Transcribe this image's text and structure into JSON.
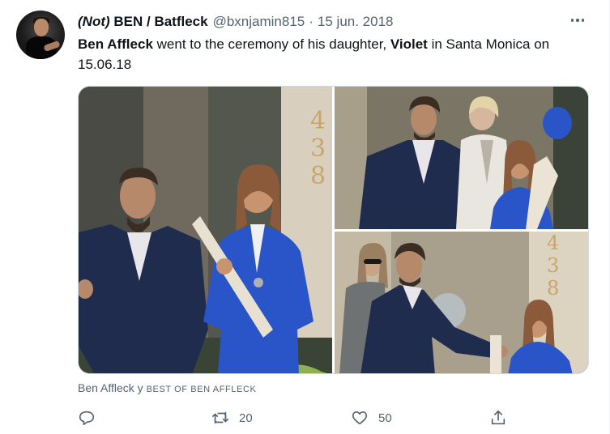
{
  "tweet": {
    "display_name_prefix": "(Not)",
    "display_name": "BEN / Batfleck",
    "handle": "@bxnjamin815",
    "separator": "·",
    "date": "15 jun. 2018",
    "text": {
      "name": "Ben Affleck",
      "part1": " went to the ceremony of his daughter, ",
      "daughter": "Violet",
      "part2": " in Santa Monica on 15.06.18"
    },
    "attribution": {
      "name": "Ben Affleck",
      "joiner": " y ",
      "other": "BEST OF BEN AFFLECK"
    },
    "actions": {
      "reply_count": "",
      "retweet_count": "20",
      "like_count": "50"
    }
  },
  "icons": [
    "more-icon",
    "reply-icon",
    "retweet-icon",
    "like-icon",
    "share-icon"
  ],
  "colors": {
    "text": "#0f1419",
    "secondary": "#536471",
    "gown_blue": "#2a55c9",
    "suit_navy": "#1f2c4d"
  }
}
